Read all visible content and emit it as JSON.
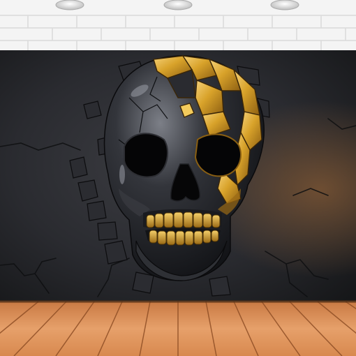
{
  "scene": {
    "subject": "skull-wall-backdrop",
    "colors": {
      "brick_wall": "#f4f4f4",
      "mortar": "#dcdcdc",
      "backdrop_dark": "#1c1d21",
      "backdrop_mid": "#3a3b40",
      "backdrop_warm_glow": "#6b4a2c",
      "chrome_dark": "#15161a",
      "chrome_highlight": "#8d9099",
      "gold": "#d9a52b",
      "gold_light": "#f3cb5c",
      "gold_dark": "#8a5f12",
      "floor_light": "#e0955e",
      "floor_dark": "#a85a2c",
      "lamp": "#e6e6e6"
    },
    "lamps_count_visible": 3
  }
}
